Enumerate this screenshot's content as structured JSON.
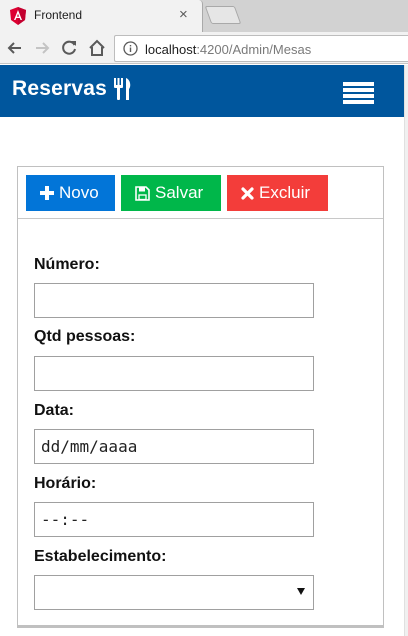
{
  "browser": {
    "tab_title": "Frontend",
    "close_glyph": "×",
    "url_host": "localhost",
    "url_path": ":4200/Admin/Mesas"
  },
  "navbar": {
    "brand": "Reservas",
    "brand_icon": "cutlery-icon",
    "menu_icon": "hamburger-menu-icon",
    "color": "#00569d"
  },
  "toolbar": {
    "novo_label": "Novo",
    "salvar_label": "Salvar",
    "excluir_label": "Excluir",
    "colors": {
      "novo": "#0275d8",
      "salvar": "#00b74a",
      "excluir": "#f33d3a"
    }
  },
  "form": {
    "numero_label": "Número:",
    "numero_value": "",
    "qtd_label": "Qtd pessoas:",
    "qtd_value": "",
    "data_label": "Data:",
    "data_value": "dd/mm/aaaa",
    "horario_label": "Horário:",
    "horario_value": "--:--",
    "estabelecimento_label": "Estabelecimento:",
    "estabelecimento_value": ""
  }
}
